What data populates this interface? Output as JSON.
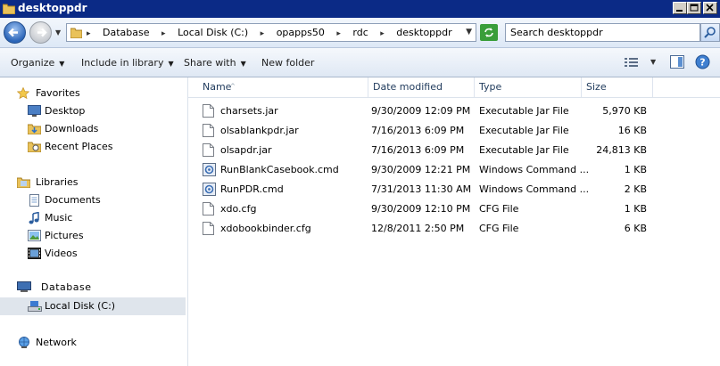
{
  "window": {
    "title": "desktoppdr"
  },
  "address": {
    "crumbs": [
      "Database",
      "Local Disk (C:)",
      "opapps50",
      "rdc",
      "desktoppdr"
    ]
  },
  "search": {
    "placeholder": "Search desktoppdr"
  },
  "toolbar": {
    "organize": "Organize",
    "include": "Include in library",
    "share": "Share with",
    "new_folder": "New folder"
  },
  "nav": {
    "favorites": "Favorites",
    "desktop": "Desktop",
    "downloads": "Downloads",
    "recent": "Recent Places",
    "libraries": "Libraries",
    "documents": "Documents",
    "music": "Music",
    "pictures": "Pictures",
    "videos": "Videos",
    "database": "Database",
    "local_disk": "Local Disk (C:)",
    "network": "Network"
  },
  "columns": {
    "name": "Name",
    "date": "Date modified",
    "type": "Type",
    "size": "Size"
  },
  "files": [
    {
      "name": "charsets.jar",
      "date": "9/30/2009 12:09 PM",
      "type": "Executable Jar File",
      "size": "5,970 KB",
      "icon": "jar-file-icon"
    },
    {
      "name": "olsablankpdr.jar",
      "date": "7/16/2013 6:09 PM",
      "type": "Executable Jar File",
      "size": "16 KB",
      "icon": "jar-file-icon"
    },
    {
      "name": "olsapdr.jar",
      "date": "7/16/2013 6:09 PM",
      "type": "Executable Jar File",
      "size": "24,813 KB",
      "icon": "jar-file-icon"
    },
    {
      "name": "RunBlankCasebook.cmd",
      "date": "9/30/2009 12:21 PM",
      "type": "Windows Command ...",
      "size": "1 KB",
      "icon": "cmd-file-icon"
    },
    {
      "name": "RunPDR.cmd",
      "date": "7/31/2013 11:30 AM",
      "type": "Windows Command ...",
      "size": "2 KB",
      "icon": "cmd-file-icon"
    },
    {
      "name": "xdo.cfg",
      "date": "9/30/2009 12:10 PM",
      "type": "CFG File",
      "size": "1 KB",
      "icon": "cfg-file-icon"
    },
    {
      "name": "xdobookbinder.cfg",
      "date": "12/8/2011 2:50 PM",
      "type": "CFG File",
      "size": "6 KB",
      "icon": "cfg-file-icon"
    }
  ],
  "colors": {
    "titlebar": "#0b2a86",
    "accent": "#1e395b",
    "selected": "#dfe5ec"
  }
}
